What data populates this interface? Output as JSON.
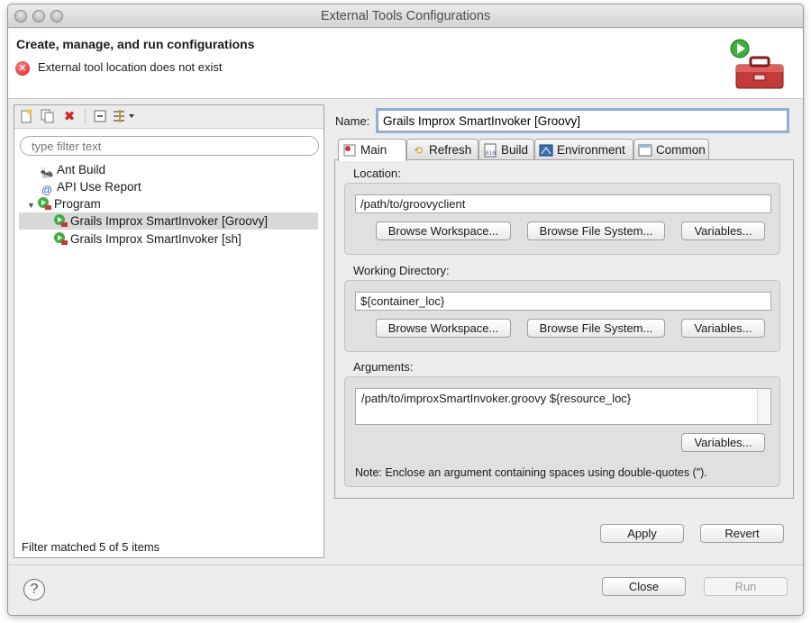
{
  "window": {
    "title": "External Tools Configurations"
  },
  "header": {
    "title": "Create, manage, and run configurations",
    "message": "External tool location does not exist",
    "toolbox_icon": "toolbox-run-icon"
  },
  "left": {
    "toolbar_icons": [
      "new-config-icon",
      "duplicate-icon",
      "delete-icon",
      "collapse-all-icon",
      "filter-icon"
    ],
    "filter_placeholder": "type filter text",
    "tree": [
      {
        "label": "Ant Build",
        "icon": "ant-icon",
        "level": 1
      },
      {
        "label": "API Use Report",
        "icon": "api-report-icon",
        "level": 1
      },
      {
        "label": "Program",
        "icon": "program-icon",
        "level": 0,
        "expanded": true
      },
      {
        "label": "Grails Improx SmartInvoker [Groovy]",
        "icon": "program-config-icon",
        "level": 2,
        "selected": true
      },
      {
        "label": "Grails Improx SmartInvoker [sh]",
        "icon": "program-config-icon",
        "level": 2
      }
    ],
    "filter_status": "Filter matched 5 of 5 items"
  },
  "right": {
    "name_label": "Name:",
    "name_value": "Grails Improx SmartInvoker [Groovy]",
    "tabs": [
      {
        "label": "Main",
        "icon": "main-tab-icon",
        "active": true
      },
      {
        "label": "Refresh",
        "icon": "refresh-icon"
      },
      {
        "label": "Build",
        "icon": "build-icon"
      },
      {
        "label": "Environment",
        "icon": "environment-icon"
      },
      {
        "label": "Common",
        "icon": "common-icon"
      }
    ],
    "location": {
      "label": "Location:",
      "value": "/path/to/groovyclient",
      "browse_workspace": "Browse Workspace...",
      "browse_fs": "Browse File System...",
      "variables": "Variables..."
    },
    "working_dir": {
      "label": "Working Directory:",
      "value": "${container_loc}",
      "browse_workspace": "Browse Workspace...",
      "browse_fs": "Browse File System...",
      "variables": "Variables..."
    },
    "arguments": {
      "label": "Arguments:",
      "value": "/path/to/improxSmartInvoker.groovy ${resource_loc}",
      "variables": "Variables...",
      "note": "Note: Enclose an argument containing spaces using double-quotes (\")."
    },
    "apply": "Apply",
    "revert": "Revert"
  },
  "footer": {
    "help": "?",
    "close": "Close",
    "run": "Run"
  },
  "colors": {
    "error": "#d21a1a",
    "selection": "#d8d8d8",
    "focus_ring": "#8db2e3"
  }
}
